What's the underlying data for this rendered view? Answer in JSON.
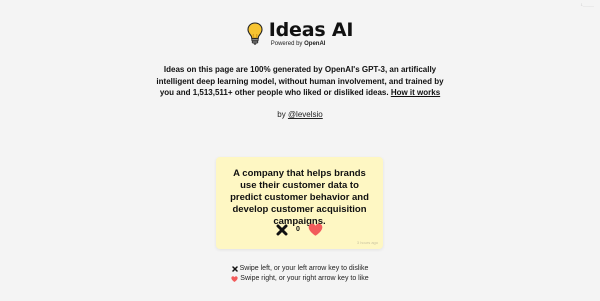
{
  "header": {
    "title": "Ideas AI",
    "powered_prefix": "Powered by",
    "powered_brand": "OpenAI",
    "corner_text": "1_____"
  },
  "intro": {
    "description": "Ideas on this page are 100% generated by OpenAI's GPT-3, an artifically intelligent deep learning model, without human involvement, and trained by you and 1,513,511+ other people who liked or disliked ideas.",
    "how_it_works": "How it works"
  },
  "byline": {
    "prefix": "by",
    "author": "@levelsio"
  },
  "idea_card": {
    "text": "A company that helps brands use their customer data to predict customer behavior and develop customer acquisition campaigns.",
    "vote_count": "0",
    "time": "3 hours ago"
  },
  "instructions": {
    "dislike": "Swipe left, or your left arrow key to dislike",
    "like": "Swipe right, or your right arrow key to like"
  },
  "colors": {
    "background": "#f4f4f4",
    "card": "#fef7c3",
    "heart": "#f25b5b",
    "bulb": "#f7c431"
  }
}
